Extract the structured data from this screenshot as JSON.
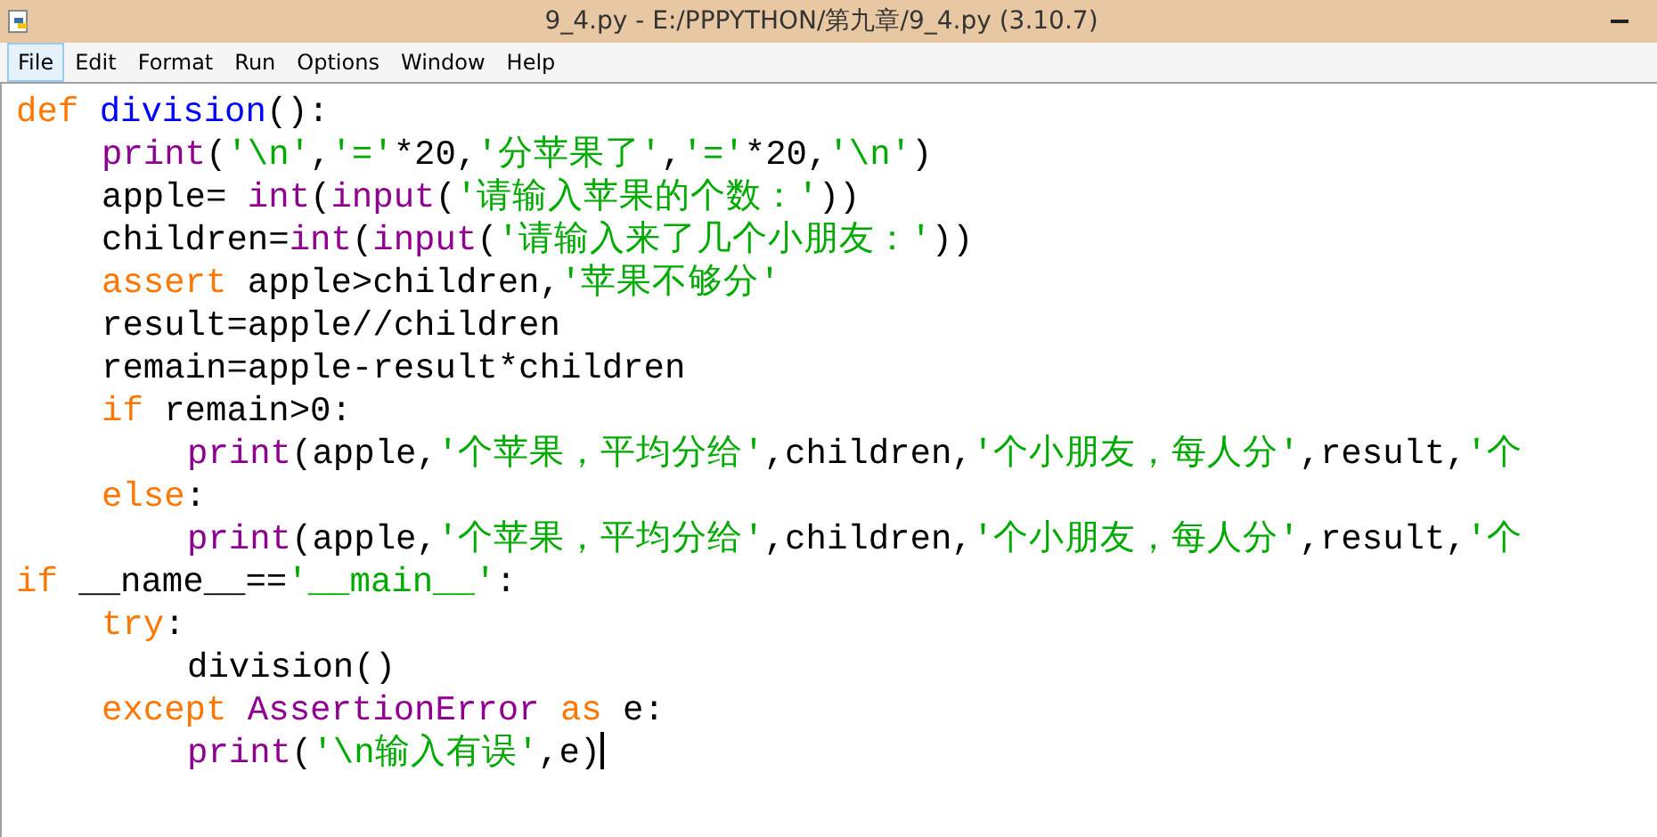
{
  "window": {
    "title": "9_4.py - E:/PPPYTHON/第九章/9_4.py (3.10.7)"
  },
  "menu": [
    {
      "label": "File",
      "selected": true
    },
    {
      "label": "Edit",
      "selected": false
    },
    {
      "label": "Format",
      "selected": false
    },
    {
      "label": "Run",
      "selected": false
    },
    {
      "label": "Options",
      "selected": false
    },
    {
      "label": "Window",
      "selected": false
    },
    {
      "label": "Help",
      "selected": false
    }
  ],
  "code": [
    {
      "tokens": [
        {
          "kind": "keyword",
          "text": "def "
        },
        {
          "kind": "definition",
          "text": "division"
        },
        {
          "kind": "plain",
          "text": "():"
        }
      ],
      "children": [
        {
          "tokens": [
            {
              "kind": "builtin",
              "text": "print"
            },
            {
              "kind": "plain",
              "text": "("
            },
            {
              "kind": "string",
              "text": "'\\n'"
            },
            {
              "kind": "plain",
              "text": ","
            },
            {
              "kind": "string",
              "text": "'='"
            },
            {
              "kind": "plain",
              "text": "*20,"
            },
            {
              "kind": "string",
              "text": "'分苹果了'"
            },
            {
              "kind": "plain",
              "text": ","
            },
            {
              "kind": "string",
              "text": "'='"
            },
            {
              "kind": "plain",
              "text": "*20,"
            },
            {
              "kind": "string",
              "text": "'\\n'"
            },
            {
              "kind": "plain",
              "text": ")"
            }
          ]
        },
        {
          "tokens": [
            {
              "kind": "plain",
              "text": "apple= "
            },
            {
              "kind": "builtin",
              "text": "int"
            },
            {
              "kind": "plain",
              "text": "("
            },
            {
              "kind": "builtin",
              "text": "input"
            },
            {
              "kind": "plain",
              "text": "("
            },
            {
              "kind": "string",
              "text": "'请输入苹果的个数：'"
            },
            {
              "kind": "plain",
              "text": "))"
            }
          ]
        },
        {
          "tokens": [
            {
              "kind": "plain",
              "text": "children="
            },
            {
              "kind": "builtin",
              "text": "int"
            },
            {
              "kind": "plain",
              "text": "("
            },
            {
              "kind": "builtin",
              "text": "input"
            },
            {
              "kind": "plain",
              "text": "("
            },
            {
              "kind": "string",
              "text": "'请输入来了几个小朋友：'"
            },
            {
              "kind": "plain",
              "text": "))"
            }
          ]
        },
        {
          "tokens": [
            {
              "kind": "keyword",
              "text": "assert"
            },
            {
              "kind": "plain",
              "text": " apple>children,"
            },
            {
              "kind": "string",
              "text": "'苹果不够分'"
            }
          ]
        },
        {
          "tokens": [
            {
              "kind": "plain",
              "text": "result=apple//children"
            }
          ]
        },
        {
          "tokens": [
            {
              "kind": "plain",
              "text": "remain=apple-result*children"
            }
          ]
        },
        {
          "tokens": [
            {
              "kind": "keyword",
              "text": "if"
            },
            {
              "kind": "plain",
              "text": " remain>0:"
            }
          ],
          "children": [
            {
              "tokens": [
                {
                  "kind": "builtin",
                  "text": "print"
                },
                {
                  "kind": "plain",
                  "text": "(apple,"
                },
                {
                  "kind": "string",
                  "text": "'个苹果，平均分给'"
                },
                {
                  "kind": "plain",
                  "text": ",children,"
                },
                {
                  "kind": "string",
                  "text": "'个小朋友，每人分'"
                },
                {
                  "kind": "plain",
                  "text": ",result,"
                },
                {
                  "kind": "string",
                  "text": "'个"
                }
              ]
            }
          ]
        },
        {
          "tokens": [
            {
              "kind": "keyword",
              "text": "else"
            },
            {
              "kind": "plain",
              "text": ":"
            }
          ],
          "children": [
            {
              "tokens": [
                {
                  "kind": "builtin",
                  "text": "print"
                },
                {
                  "kind": "plain",
                  "text": "(apple,"
                },
                {
                  "kind": "string",
                  "text": "'个苹果，平均分给'"
                },
                {
                  "kind": "plain",
                  "text": ",children,"
                },
                {
                  "kind": "string",
                  "text": "'个小朋友，每人分'"
                },
                {
                  "kind": "plain",
                  "text": ",result,"
                },
                {
                  "kind": "string",
                  "text": "'个"
                }
              ]
            }
          ]
        }
      ]
    },
    {
      "tokens": [
        {
          "kind": "keyword",
          "text": "if"
        },
        {
          "kind": "plain",
          "text": " __name__=="
        },
        {
          "kind": "string",
          "text": "'__main__'"
        },
        {
          "kind": "plain",
          "text": ":"
        }
      ],
      "children": [
        {
          "tokens": [
            {
              "kind": "keyword",
              "text": "try"
            },
            {
              "kind": "plain",
              "text": ":"
            }
          ],
          "children": [
            {
              "tokens": [
                {
                  "kind": "plain",
                  "text": "division()"
                }
              ]
            }
          ]
        },
        {
          "tokens": [
            {
              "kind": "keyword",
              "text": "except "
            },
            {
              "kind": "builtin",
              "text": "AssertionError "
            },
            {
              "kind": "keyword",
              "text": "as"
            },
            {
              "kind": "plain",
              "text": " e:"
            }
          ],
          "children": [
            {
              "tokens": [
                {
                  "kind": "builtin",
                  "text": "print"
                },
                {
                  "kind": "plain",
                  "text": "("
                },
                {
                  "kind": "string",
                  "text": "'\\n输入有误'"
                },
                {
                  "kind": "plain",
                  "text": ",e)"
                }
              ],
              "cursor": true
            }
          ]
        }
      ]
    }
  ]
}
